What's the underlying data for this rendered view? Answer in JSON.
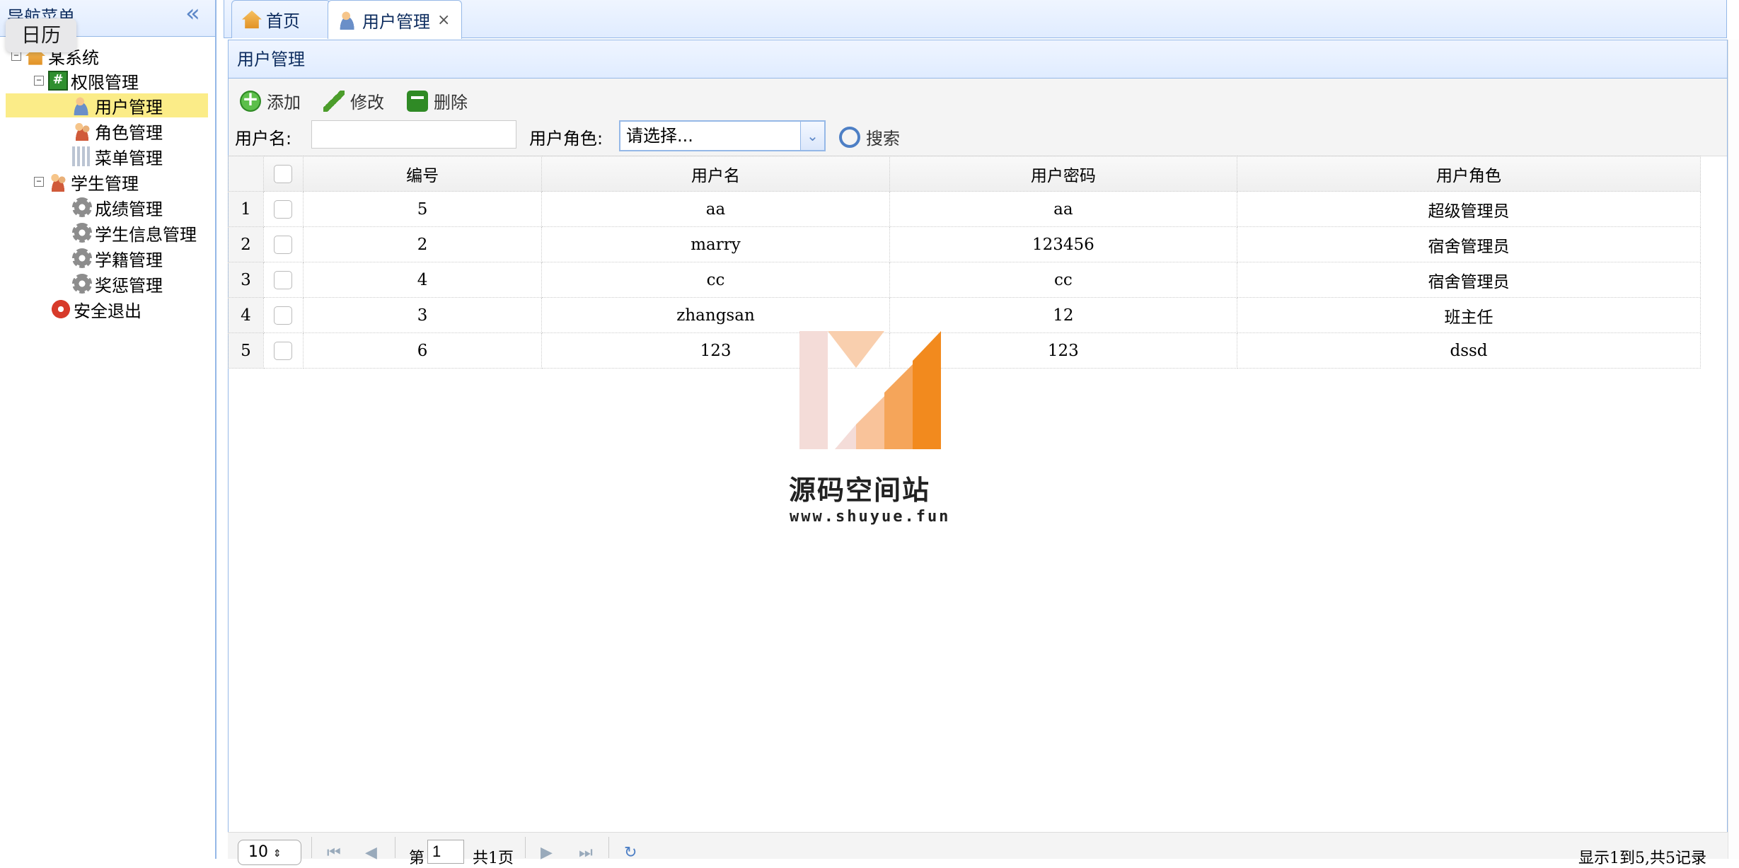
{
  "nav": {
    "title": "导航菜单",
    "tooltip": "日历",
    "tree": [
      {
        "label": "某系统",
        "icon": "home-icon",
        "toggle": "−"
      },
      {
        "label": "权限管理",
        "icon": "hash-icon",
        "toggle": "−"
      },
      {
        "label": "用户管理",
        "icon": "user-icon",
        "selected": true
      },
      {
        "label": "角色管理",
        "icon": "users-icon"
      },
      {
        "label": "菜单管理",
        "icon": "menu-tree-icon"
      },
      {
        "label": "学生管理",
        "icon": "students-icon",
        "toggle": "−"
      },
      {
        "label": "成绩管理",
        "icon": "gear-icon"
      },
      {
        "label": "学生信息管理",
        "icon": "gear-icon"
      },
      {
        "label": "学籍管理",
        "icon": "gear-icon"
      },
      {
        "label": "奖惩管理",
        "icon": "gear-icon"
      },
      {
        "label": "安全退出",
        "icon": "exit-icon"
      }
    ]
  },
  "tabs": [
    {
      "label": "首页",
      "icon": "home-icon"
    },
    {
      "label": "用户管理",
      "icon": "user-icon",
      "closable": "×"
    }
  ],
  "panel": {
    "title": "用户管理"
  },
  "toolbar": {
    "add": "添加",
    "edit": "修改",
    "delete": "删除",
    "search": "搜索"
  },
  "search": {
    "username_label": "用户名:",
    "username_value": "",
    "role_label": "用户角色:",
    "role_selected": "请选择..."
  },
  "table": {
    "headers": [
      "编号",
      "用户名",
      "用户密码",
      "用户角色"
    ],
    "rows": [
      {
        "n": "1",
        "id": "5",
        "name": "aa",
        "pwd": "aa",
        "role": "超级管理员"
      },
      {
        "n": "2",
        "id": "2",
        "name": "marry",
        "pwd": "123456",
        "role": "宿舍管理员"
      },
      {
        "n": "3",
        "id": "4",
        "name": "cc",
        "pwd": "cc",
        "role": "宿舍管理员"
      },
      {
        "n": "4",
        "id": "3",
        "name": "zhangsan",
        "pwd": "12",
        "role": "班主任"
      },
      {
        "n": "5",
        "id": "6",
        "name": "123",
        "pwd": "123",
        "role": "dssd"
      }
    ]
  },
  "watermark": {
    "text": "源码空间站",
    "url": "www.shuyue.fun"
  },
  "pager": {
    "page_size": "10",
    "page_prefix": "第",
    "page_number": "1",
    "page_total": "共1页",
    "info": "显示1到5,共5记录"
  },
  "colors": {
    "border": "#95b8e7",
    "header_bg": "#e0ecff",
    "selected": "#fbec88",
    "wm_orange": "#f28a1e"
  }
}
